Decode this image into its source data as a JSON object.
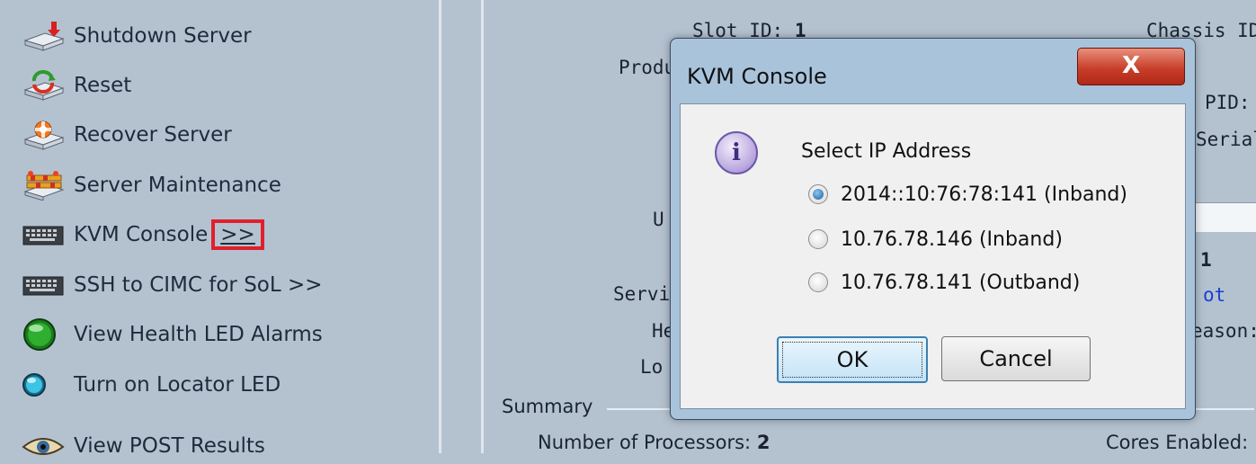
{
  "actions": [
    {
      "label": "Shutdown Server",
      "icon": "shutdown-server-icon"
    },
    {
      "label": "Reset",
      "icon": "reset-icon"
    },
    {
      "label": "Recover Server",
      "icon": "recover-server-icon"
    },
    {
      "label": "Server Maintenance",
      "icon": "server-maintenance-icon"
    },
    {
      "label": "KVM Console",
      "more": ">>",
      "icon": "keyboard-icon"
    },
    {
      "label": "SSH to CIMC for SoL >>",
      "icon": "keyboard-icon"
    },
    {
      "label": "View Health LED Alarms",
      "icon": "green-led-icon"
    },
    {
      "label": "Turn on Locator LED",
      "icon": "blue-led-icon"
    },
    {
      "label": "View POST Results",
      "icon": "eye-icon"
    }
  ],
  "server_info": {
    "slot_id_label": "Slot ID:",
    "slot_id_value": "1",
    "chassis_id_label": "Chassis ID:",
    "product_label": "Produ",
    "pid_label": "PID:",
    "serial_label": "Serial:",
    "u_label": "U",
    "service_label": "Servi",
    "he_label": "He",
    "loc_label": "Lo",
    "right_value_1": "1",
    "right_link": "ot",
    "reason_label": "eason:",
    "summary_label": "Summary",
    "num_processors_label": "Number of Processors:",
    "num_processors_value": "2",
    "cores_enabled_label": "Cores Enabled:"
  },
  "dialog": {
    "title": "KVM Console",
    "close_label": "X",
    "prompt": "Select IP Address",
    "options": [
      {
        "label": "2014::10:76:78:141 (Inband)",
        "selected": true
      },
      {
        "label": "10.76.78.146 (Inband)",
        "selected": false
      },
      {
        "label": "10.76.78.141 (Outband)",
        "selected": false
      }
    ],
    "ok_label": "OK",
    "cancel_label": "Cancel"
  },
  "colors": {
    "panel_bg": "#b4c2d0",
    "highlight_border": "#e0202c",
    "close_button": "#c8402a"
  }
}
